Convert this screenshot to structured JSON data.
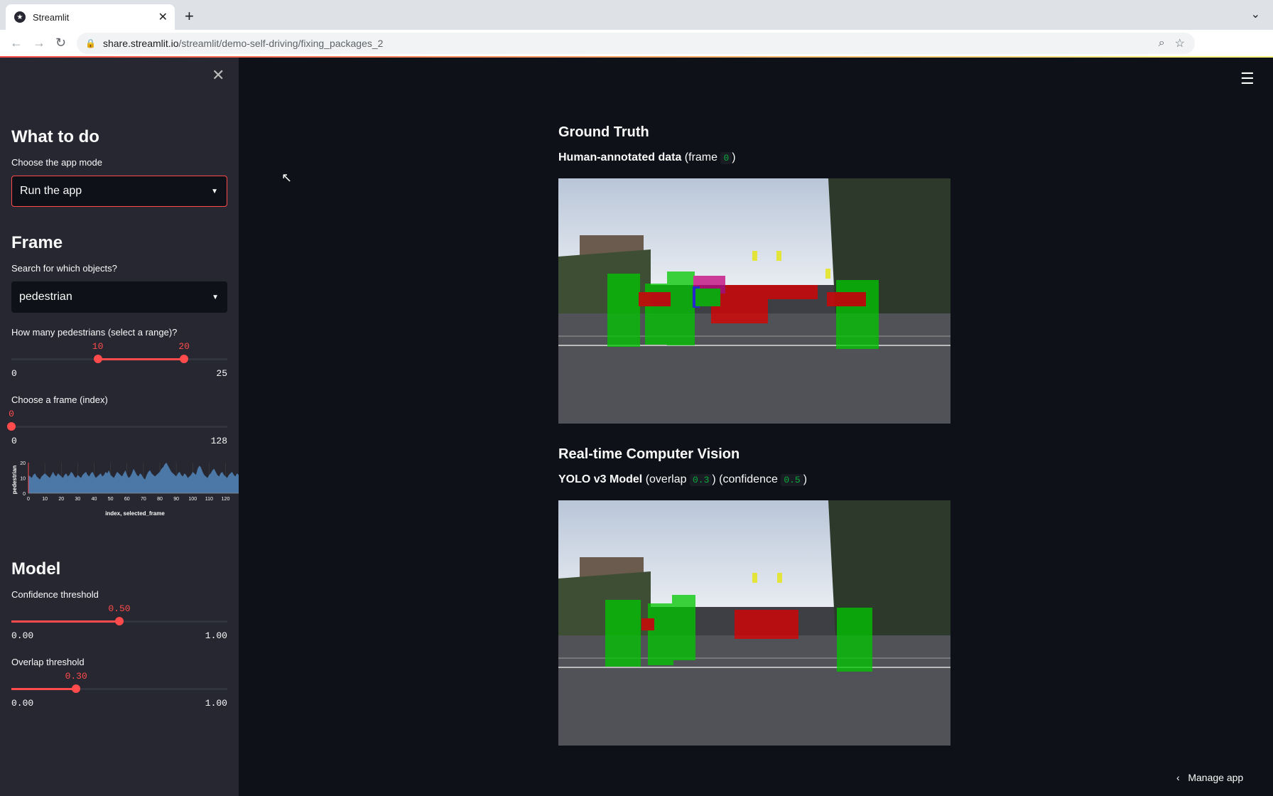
{
  "browser": {
    "tab_title": "Streamlit",
    "url_host": "share.streamlit.io",
    "url_path": "/streamlit/demo-self-driving/fixing_packages_2"
  },
  "sidebar": {
    "section_what": "What to do",
    "mode_label": "Choose the app mode",
    "mode_value": "Run the app",
    "section_frame": "Frame",
    "objects_label": "Search for which objects?",
    "objects_value": "pedestrian",
    "range_label": "How many pedestrians (select a range)?",
    "range": {
      "low": 10,
      "high": 20,
      "min": 0,
      "max": 25,
      "low_text": "10",
      "high_text": "20",
      "min_text": "0",
      "max_text": "25"
    },
    "frame_label": "Choose a frame (index)",
    "frame": {
      "value": 0,
      "min": 0,
      "max": 128,
      "value_text": "0",
      "min_text": "0",
      "max_text": "128"
    },
    "section_model": "Model",
    "confidence_label": "Confidence threshold",
    "confidence": {
      "value": 0.5,
      "min": 0,
      "max": 1,
      "value_text": "0.50",
      "min_text": "0.00",
      "max_text": "1.00"
    },
    "overlap_label": "Overlap threshold",
    "overlap": {
      "value": 0.3,
      "min": 0,
      "max": 1,
      "value_text": "0.30",
      "min_text": "0.00",
      "max_text": "1.00"
    }
  },
  "chart_data": {
    "type": "area",
    "xlabel": "index, selected_frame",
    "ylabel": "pedestrian",
    "xlim": [
      0,
      128
    ],
    "ylim": [
      0,
      20
    ],
    "x_ticks": [
      0,
      10,
      20,
      30,
      40,
      50,
      60,
      70,
      80,
      90,
      100,
      110,
      120
    ],
    "y_ticks": [
      0,
      10,
      20
    ],
    "selected_frame": 0,
    "color": "#4c78a8",
    "values": [
      12,
      11,
      10,
      12,
      13,
      11,
      10,
      9,
      11,
      12,
      13,
      12,
      11,
      10,
      12,
      14,
      12,
      11,
      13,
      12,
      11,
      10,
      12,
      13,
      11,
      12,
      14,
      13,
      11,
      10,
      12,
      11,
      10,
      12,
      13,
      14,
      12,
      11,
      13,
      14,
      12,
      10,
      11,
      12,
      13,
      11,
      12,
      14,
      13,
      15,
      12,
      11,
      10,
      12,
      14,
      13,
      12,
      11,
      13,
      15,
      12,
      10,
      11,
      13,
      16,
      14,
      12,
      11,
      13,
      12,
      10,
      9,
      12,
      14,
      15,
      13,
      12,
      11,
      12,
      13,
      14,
      16,
      17,
      19,
      20,
      18,
      16,
      14,
      13,
      12,
      11,
      13,
      14,
      12,
      11,
      13,
      12,
      10,
      11,
      12,
      14,
      13,
      12,
      16,
      18,
      17,
      14,
      12,
      11,
      10,
      12,
      13,
      15,
      16,
      14,
      12,
      11,
      13,
      14,
      12,
      11,
      10,
      12,
      13,
      14,
      12,
      11,
      13,
      12
    ]
  },
  "main": {
    "gt_heading": "Ground Truth",
    "gt_caption_bold": "Human-annotated data",
    "gt_caption_pre": "(frame",
    "gt_frame": "0",
    "gt_caption_post": ")",
    "cv_heading": "Real-time Computer Vision",
    "cv_caption_bold": "YOLO v3 Model",
    "cv_caption_overlap_pre": "(overlap",
    "cv_overlap": "0.3",
    "cv_caption_conf_pre": ") (confidence",
    "cv_confidence": "0.5",
    "cv_caption_post": ")"
  },
  "manage_app": "Manage app",
  "colors": {
    "accent": "#ff4b4b",
    "sidebar_bg": "#262730",
    "main_bg": "#0e1117",
    "pedestrian_box": "#00c800",
    "car_box": "#e00000",
    "light_box": "#e6e600"
  }
}
